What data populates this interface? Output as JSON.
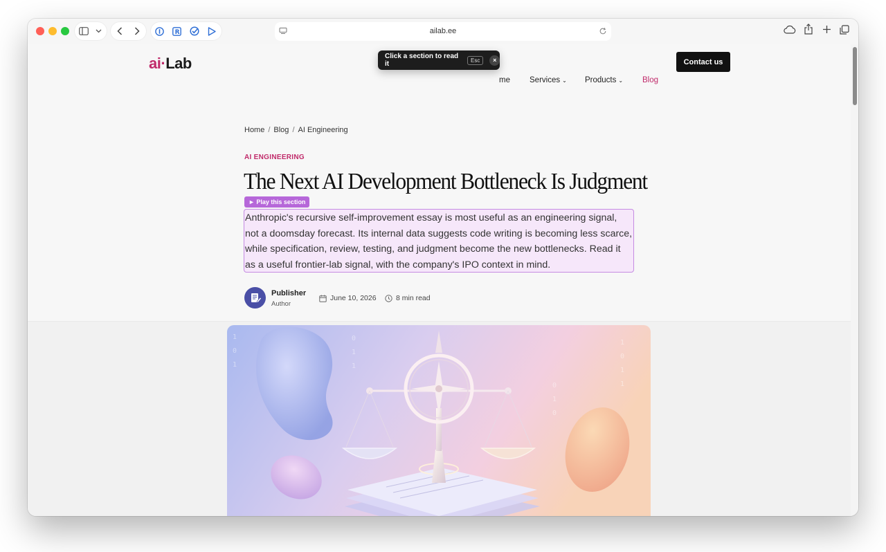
{
  "browser": {
    "url": "ailab.ee"
  },
  "site": {
    "logo_ai": "ai",
    "logo_dot": "·",
    "logo_lab": "Lab",
    "nav": {
      "home_partial": "me",
      "services": "Services",
      "products": "Products",
      "blog": "Blog",
      "contact": "Contact us"
    }
  },
  "toast": {
    "message": "Click a section to read it",
    "esc_key": "Esc",
    "close": "×"
  },
  "breadcrumb": {
    "home": "Home",
    "blog": "Blog",
    "current": "AI Engineering",
    "separator": "/"
  },
  "article": {
    "category": "AI ENGINEERING",
    "title": "The Next AI Development Bottleneck Is Judgment",
    "play_label": "► Play this section",
    "intro": "Anthropic's recursive self-improvement essay is most useful as an engineering signal, not a doomsday forecast. Its internal data suggests code writing is becoming less scarce, while specification, review, testing, and judgment become the new bottlenecks. Read it as a useful frontier-lab signal, with the company's IPO context in mind.",
    "author_name": "Publisher",
    "author_role": "Author",
    "date": "June 10, 2026",
    "read_time": "8 min read"
  },
  "colors": {
    "brand": "#c02a6a",
    "highlight_border": "#c58be2",
    "highlight_bg": "#f6e7fa",
    "play_pill": "#b667d9"
  },
  "icons": [
    "sidebar-icon",
    "chevron-down-icon",
    "back-icon",
    "forward-icon",
    "password-icon",
    "extension-icon",
    "check-icon",
    "play-icon",
    "reader-icon",
    "reload-icon",
    "cloud-icon",
    "share-icon",
    "plus-icon",
    "tabs-icon",
    "calendar-icon",
    "clock-icon"
  ]
}
